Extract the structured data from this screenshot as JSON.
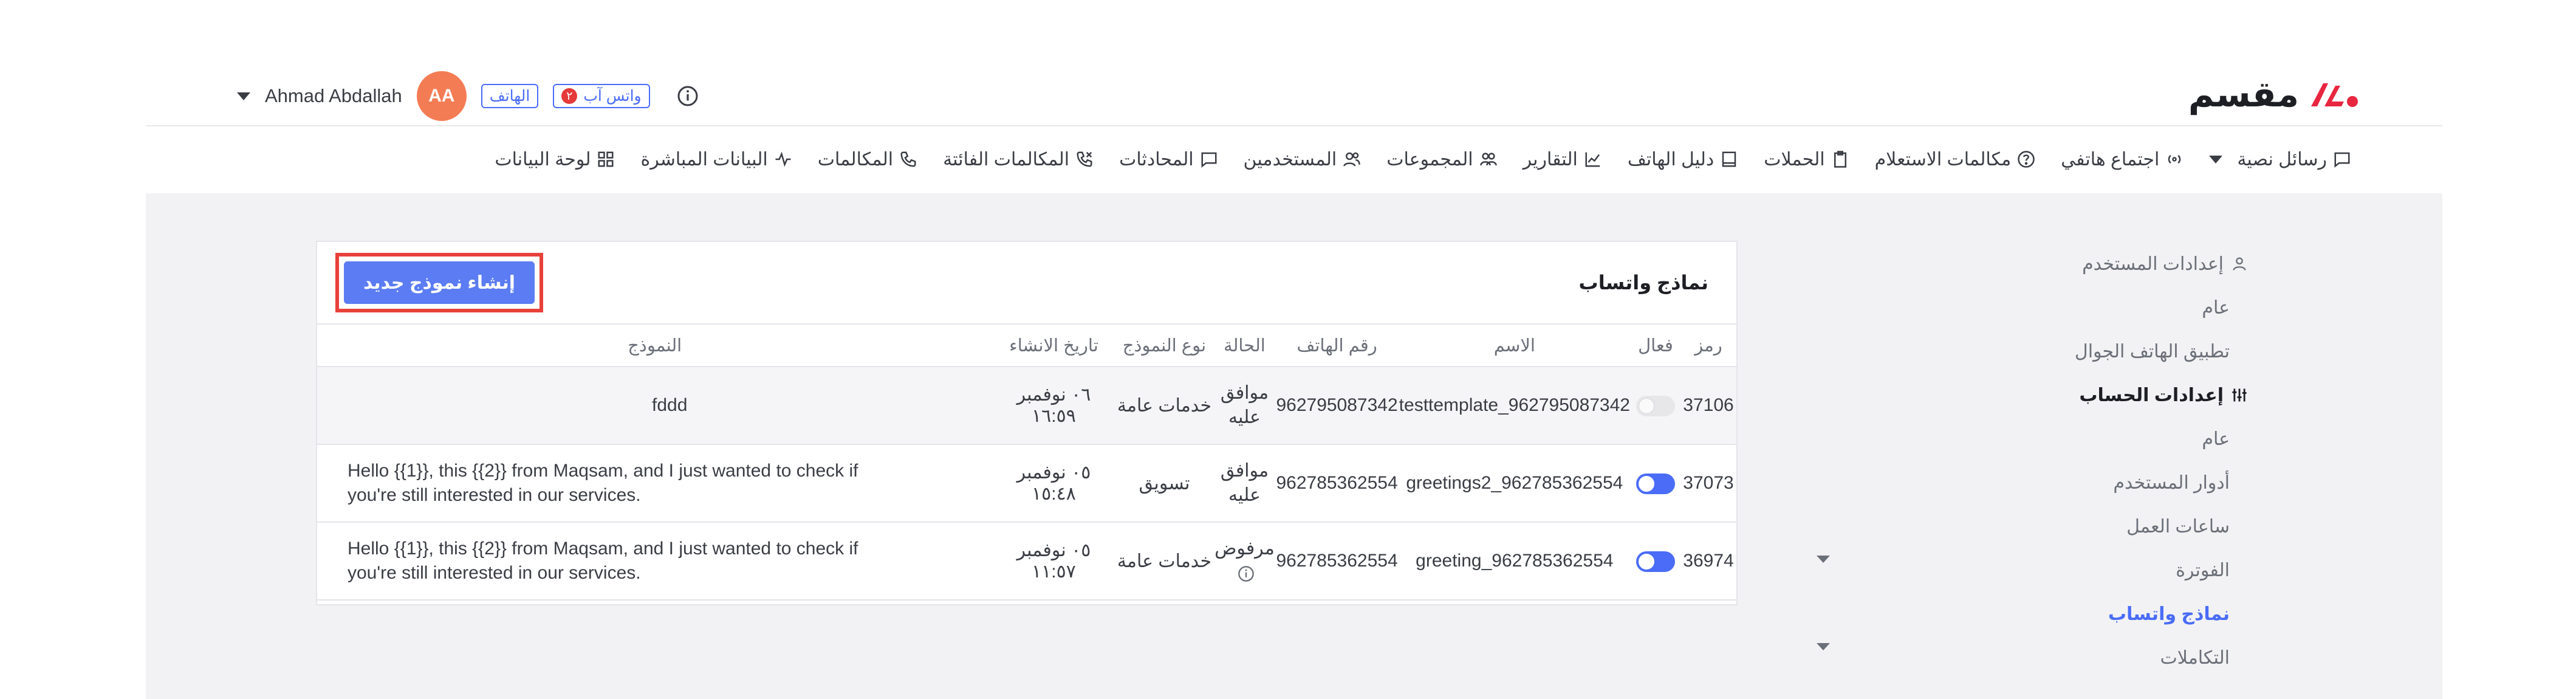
{
  "brand": {
    "logo_text": "مقسم",
    "accent": "#e8263f"
  },
  "user": {
    "name": "Ahmad Abdallah",
    "initials": "AA",
    "avatar_color": "#f47c54"
  },
  "channels": {
    "phone_label": "الهاتف",
    "whatsapp_label": "واتس آب",
    "whatsapp_count": "٢"
  },
  "nav": {
    "items": [
      {
        "label": "لوحة البيانات",
        "icon": "grid-icon"
      },
      {
        "label": "البيانات المباشرة",
        "icon": "pulse-icon"
      },
      {
        "label": "المكالمات",
        "icon": "phone-icon"
      },
      {
        "label": "المكالمات الفائتة",
        "icon": "missed-call-icon"
      },
      {
        "label": "المحادثات",
        "icon": "chat-icon"
      },
      {
        "label": "المستخدمين",
        "icon": "users-icon"
      },
      {
        "label": "المجموعات",
        "icon": "group-icon"
      },
      {
        "label": "التقارير",
        "icon": "chart-icon"
      },
      {
        "label": "دليل الهاتف",
        "icon": "book-icon"
      },
      {
        "label": "الحملات",
        "icon": "clipboard-icon"
      },
      {
        "label": "مكالمات الاستعلام",
        "icon": "question-icon"
      },
      {
        "label": "اجتماع هاتفي",
        "icon": "broadcast-icon"
      },
      {
        "label": "رسائل نصية",
        "icon": "sms-icon"
      }
    ]
  },
  "sidebar": {
    "user_settings": "إعدادات المستخدم",
    "user_general": "عام",
    "mobile_app": "تطبيق الهاتف الجوال",
    "account_settings": "إعدادات الحساب",
    "account_general": "عام",
    "user_roles": "أدوار المستخدم",
    "work_hours": "ساعات العمل",
    "billing": "الفوترة",
    "whatsapp_templates": "نماذج واتساب",
    "integrations": "التكاملات"
  },
  "card": {
    "title": "نماذج واتساب",
    "new_button": "إنشاء نموذج جديد",
    "columns": {
      "code": "رمز",
      "active": "فعال",
      "name": "الاسم",
      "phone": "رقم الهاتف",
      "status": "الحالة",
      "type": "نوع النموذج",
      "created": "تاريخ الانشاء",
      "template": "النموذج"
    },
    "rows": [
      {
        "code": "37106",
        "active": false,
        "name": "testtemplate_962795087342",
        "phone": "962795087342",
        "status_line1": "موافق",
        "status_line2": "عليه",
        "type": "خدمات عامة",
        "created": "٠٦ نوفمبر ١٦:٥٩",
        "template_line1": "fddd",
        "template_line2": ""
      },
      {
        "code": "37073",
        "active": true,
        "name": "greetings2_962785362554",
        "phone": "962785362554",
        "status_line1": "موافق",
        "status_line2": "عليه",
        "type": "تسويق",
        "created": "٠٥ نوفمبر ١٥:٤٨",
        "template_line1": "Hello {{1}}, this {{2}} from Maqsam, and I just wanted to check if",
        "template_line2": "you're still interested in our services."
      },
      {
        "code": "36974",
        "active": true,
        "name": "greeting_962785362554",
        "phone": "962785362554",
        "status_line1": "مرفوض",
        "status_line2": "",
        "type": "خدمات عامة",
        "created": "٠٥ نوفمبر ١١:٥٧",
        "template_line1": "Hello {{1}}, this {{2}} from Maqsam, and I just wanted to check if",
        "template_line2": "you're still interested in our services."
      }
    ]
  }
}
